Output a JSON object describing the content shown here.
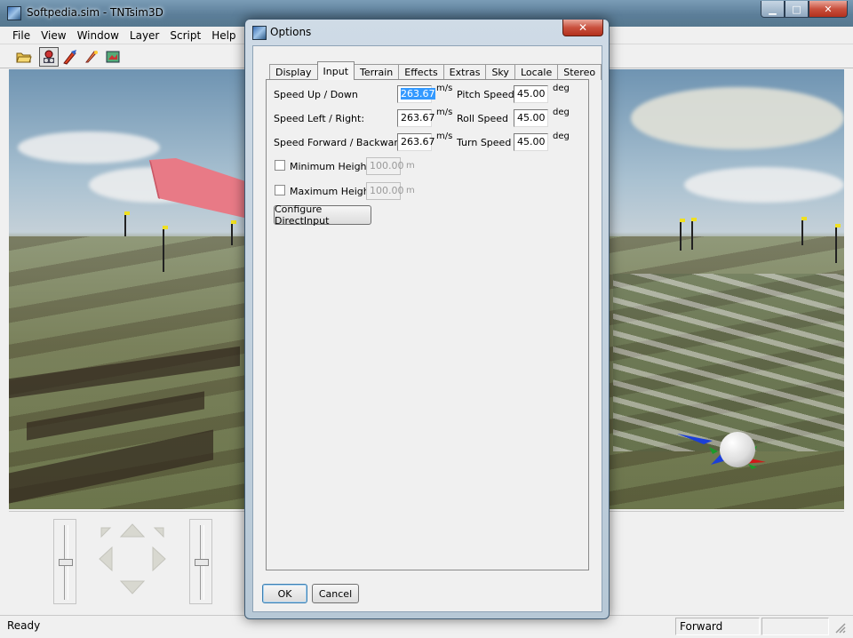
{
  "app": {
    "title": "Softpedia.sim - TNTsim3D",
    "menu": [
      "File",
      "View",
      "Window",
      "Layer",
      "Script",
      "Help"
    ],
    "toolbar": [
      {
        "icon": "open-folder-icon",
        "pressed": false
      },
      {
        "icon": "camera-view-icon",
        "pressed": true
      },
      {
        "icon": "fly-tool-icon",
        "pressed": false
      },
      {
        "icon": "pointer-tool-icon",
        "pressed": false
      },
      {
        "icon": "overlay-tool-icon",
        "pressed": false
      }
    ]
  },
  "statusbar": {
    "left": "Ready",
    "mode": "Forward"
  },
  "dialog": {
    "title": "Options",
    "close_label": "✕",
    "tabs": [
      "Display",
      "Input",
      "Terrain",
      "Effects",
      "Extras",
      "Sky",
      "Locale",
      "Stereo"
    ],
    "active_tab": "Input",
    "input": {
      "rows": [
        {
          "label": "Speed Up / Down",
          "value": "263.67",
          "unit": "m/s",
          "rot_label": "Pitch Speed",
          "rot_value": "45.00",
          "rot_unit": "deg"
        },
        {
          "label": "Speed Left / Right:",
          "value": "263.67",
          "unit": "m/s",
          "rot_label": "Roll Speed",
          "rot_value": "45.00",
          "rot_unit": "deg"
        },
        {
          "label": "Speed Forward / Backward:",
          "value": "263.67",
          "unit": "m/s",
          "rot_label": "Turn Speed",
          "rot_value": "45.00",
          "rot_unit": "deg"
        }
      ],
      "min_height": {
        "label": "Minimum Height",
        "value": "100.00",
        "unit": "m",
        "checked": false
      },
      "max_height": {
        "label": "Maximum Height",
        "value": "100.00",
        "unit": "m",
        "checked": false
      },
      "configure_button": "Configure DirectInput"
    },
    "ok_label": "OK",
    "cancel_label": "Cancel"
  }
}
